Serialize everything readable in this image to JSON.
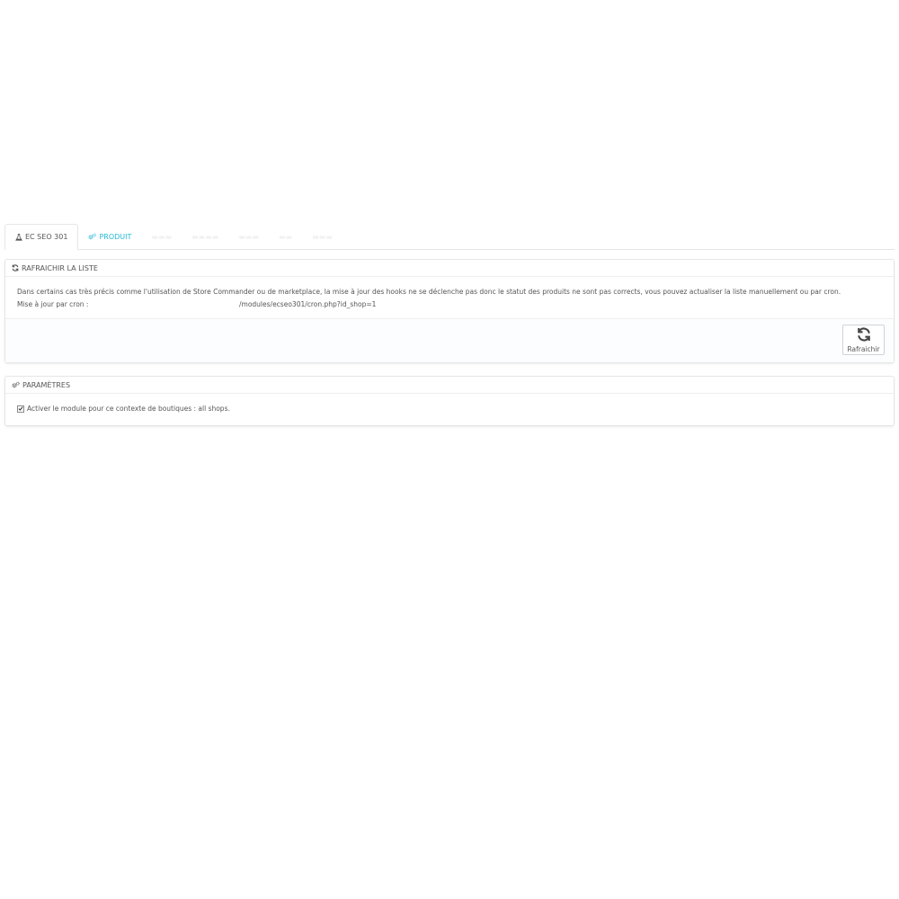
{
  "tabs": [
    {
      "label": "EC SEO 301",
      "icon": "flask-icon",
      "active": true
    },
    {
      "label": "PRODUIT",
      "icon": "cogs-icon",
      "active": false
    }
  ],
  "refresh_panel": {
    "title": "RAFRAICHIR LA LISTE",
    "icon": "refresh-icon",
    "description": "Dans certains cas très précis comme l'utilisation de Store Commander ou de marketplace, la mise à jour des hooks ne se déclenche pas donc le statut des produits ne sont pas corrects, vous pouvez actualiser la liste manuellement ou par cron.",
    "cron_label": "Mise à jour par cron :",
    "cron_url": "/modules/ecseo301/cron.php?id_shop=1",
    "button_label": "Rafraichir"
  },
  "settings_panel": {
    "title": "PARAMÈTRES",
    "icon": "cogs-icon",
    "checkbox_label": "Activer le module pour ce contexte de boutiques : all shops.",
    "checkbox_checked": true
  },
  "colors": {
    "link": "#25b9d7",
    "text": "#555555",
    "border": "#e6e6e6"
  }
}
